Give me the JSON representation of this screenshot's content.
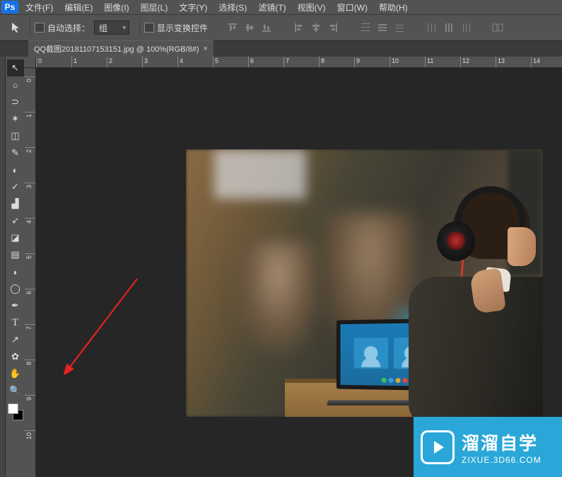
{
  "menu": {
    "items": [
      "文件(F)",
      "编辑(E)",
      "图像(I)",
      "图层(L)",
      "文字(Y)",
      "选择(S)",
      "滤镜(T)",
      "视图(V)",
      "窗口(W)",
      "帮助(H)"
    ]
  },
  "options": {
    "auto_select_label": "自动选择：",
    "group_value": "组",
    "show_transform_label": "显示变换控件"
  },
  "tab": {
    "title": "QQ截图20181107153151.jpg @ 100%(RGB/8#)"
  },
  "ruler": {
    "h": [
      "0",
      "1",
      "2",
      "3",
      "4",
      "5",
      "6",
      "7",
      "8",
      "9",
      "10",
      "11",
      "12",
      "13",
      "14"
    ],
    "v": [
      "0",
      "1",
      "2",
      "3",
      "4",
      "5",
      "6",
      "7",
      "8",
      "9",
      "10"
    ]
  },
  "tools": [
    {
      "name": "move-tool",
      "glyph": "↖"
    },
    {
      "name": "marquee-ellipse-tool",
      "glyph": "○"
    },
    {
      "name": "lasso-tool",
      "glyph": "⊃"
    },
    {
      "name": "magic-wand-tool",
      "glyph": "✶"
    },
    {
      "name": "crop-tool",
      "glyph": "◫"
    },
    {
      "name": "eyedropper-tool",
      "glyph": "✎"
    },
    {
      "name": "healing-brush-tool",
      "glyph": "◐"
    },
    {
      "name": "brush-tool",
      "glyph": "✓"
    },
    {
      "name": "clone-stamp-tool",
      "glyph": "▟"
    },
    {
      "name": "history-brush-tool",
      "glyph": "➶"
    },
    {
      "name": "eraser-tool",
      "glyph": "◪"
    },
    {
      "name": "gradient-tool",
      "glyph": "▤"
    },
    {
      "name": "blur-tool",
      "glyph": "◗"
    },
    {
      "name": "dodge-tool",
      "glyph": "◯"
    },
    {
      "name": "pen-tool",
      "glyph": "✒"
    },
    {
      "name": "type-tool",
      "glyph": "T"
    },
    {
      "name": "path-selection-tool",
      "glyph": "↗"
    },
    {
      "name": "shape-tool",
      "glyph": "✿"
    },
    {
      "name": "hand-tool",
      "glyph": "✋"
    },
    {
      "name": "zoom-tool",
      "glyph": "🔍"
    }
  ],
  "watermark": {
    "main": "溜溜自学",
    "sub": "ZIXUE.3D66.COM"
  }
}
